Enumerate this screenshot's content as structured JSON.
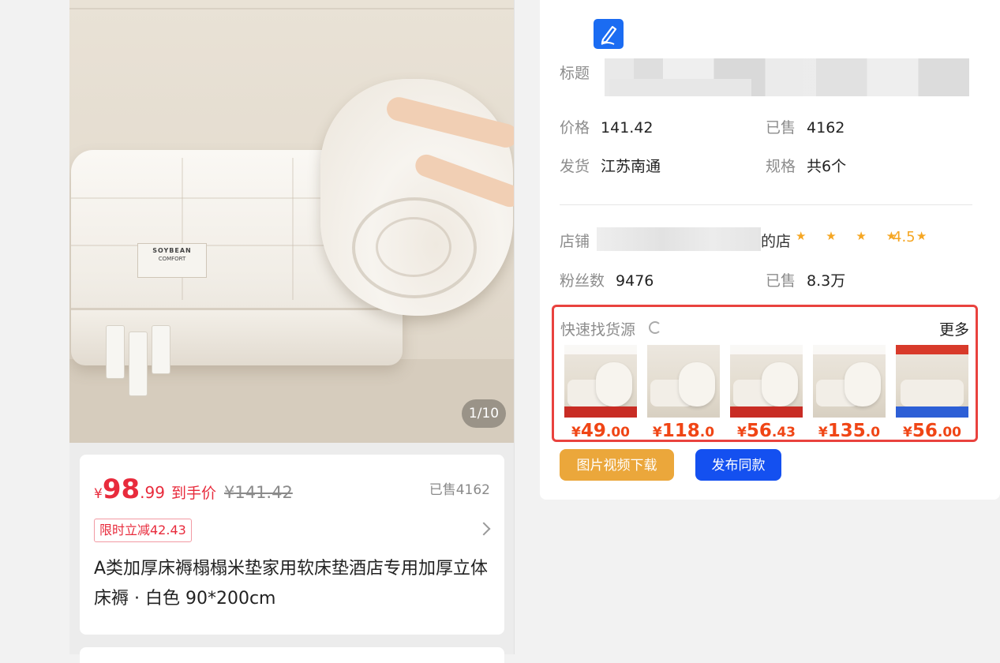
{
  "product": {
    "image_counter": "1/10",
    "price_yen": "¥",
    "price_int": "98",
    "price_dec": ".99",
    "price_after_label": "到手价",
    "original_price": "¥141.42",
    "sold": "已售4162",
    "promo_badge": "限时立减42.43",
    "title": "A类加厚床褥榻榻米垫家用软床垫酒店专用加厚立体床褥 · 白色 90*200cm",
    "mattress_brand": "SOYBEAN",
    "mattress_sub": "COMFORT"
  },
  "panel": {
    "title_label": "标题",
    "price_label": "价格",
    "price_value": "141.42",
    "sold_label": "已售",
    "sold_value": "4162",
    "ship_label": "发货",
    "ship_value": "江苏南通",
    "spec_label": "规格",
    "spec_value": "共6个",
    "shop_label": "店铺",
    "shop_suffix": "的店",
    "stars": "★ ★ ★ ★ ★",
    "rating": "4.5",
    "fans_label": "粉丝数",
    "fans_value": "9476",
    "shop_sold_label": "已售",
    "shop_sold_value": "8.3万"
  },
  "source": {
    "title": "快速找货源",
    "more": "更多",
    "items": [
      {
        "yen": "¥",
        "int": "49",
        "dec": ".00"
      },
      {
        "yen": "¥",
        "int": "118",
        "dec": ".0"
      },
      {
        "yen": "¥",
        "int": "56",
        "dec": ".43"
      },
      {
        "yen": "¥",
        "int": "135",
        "dec": ".0"
      },
      {
        "yen": "¥",
        "int": "56",
        "dec": ".00"
      }
    ]
  },
  "actions": {
    "download": "图片视频下载",
    "publish": "发布同款"
  },
  "colors": {
    "accent_blue": "#1450f0",
    "price_red": "#e82b3c",
    "highlight_border": "#e9423e",
    "download_orange": "#eba73b"
  }
}
